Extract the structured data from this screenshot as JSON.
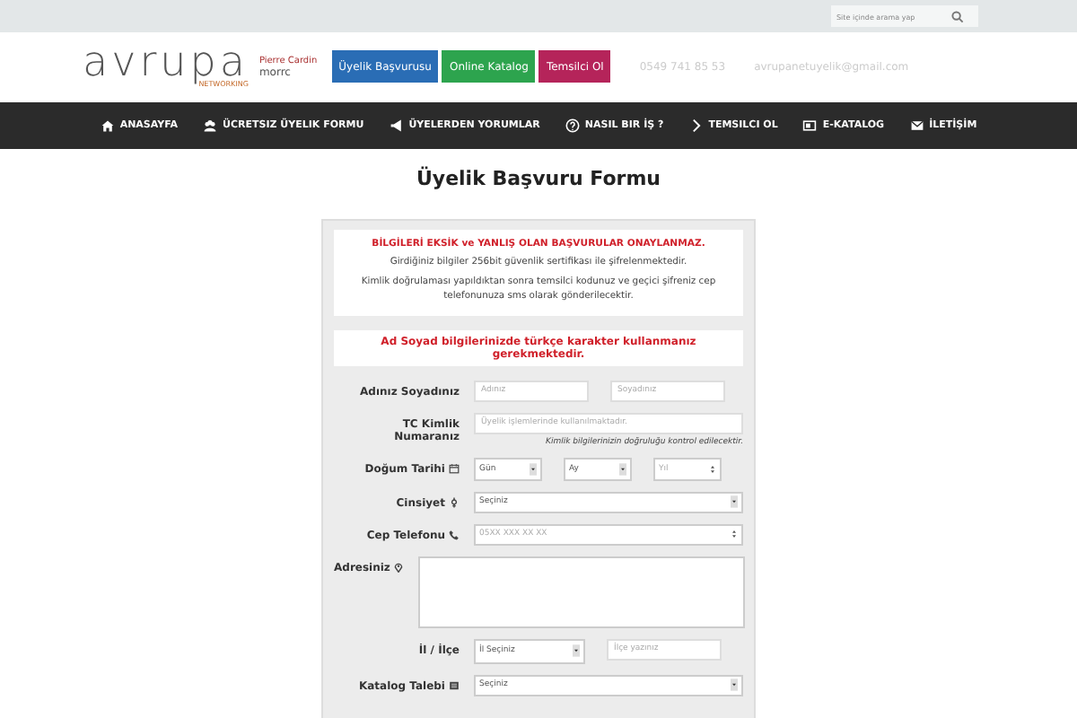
{
  "top_bar": {
    "search": {
      "placeholder": "Site içinde arama yap"
    }
  },
  "header": {
    "logo": {
      "name": "avrupa",
      "sub": "NETWORKING"
    },
    "partner_logos": [
      "Pierre Cardin",
      "morrc"
    ],
    "buttons": [
      {
        "label": "Üyelik Başvurusu",
        "color": "#2a6db5"
      },
      {
        "label": "Online Katalog",
        "color": "#2da44e"
      },
      {
        "label": "Temsilci Ol",
        "color": "#b5245a"
      }
    ],
    "phone": "0549 741 85 53",
    "email": "avrupanetuyelik@gmail.com"
  },
  "nav": [
    {
      "label": "ANASAYFA"
    },
    {
      "label": "ÜCRETSIZ ÜYELIK FORMU"
    },
    {
      "label": "ÜYELERDEN YORUMLAR"
    },
    {
      "label": "NASIL BIR İŞ ?"
    },
    {
      "label": "TEMSILCI OL"
    },
    {
      "label": "E-KATALOG"
    },
    {
      "label": "İLETİŞİM"
    }
  ],
  "page_title": "Üyelik Başvuru Formu",
  "notice": {
    "warning": "BİLGİLERİ EKSİK ve YANLIŞ OLAN BAŞVURULAR ONAYLANMAZ.",
    "lines": [
      "Girdiğiniz bilgiler 256bit güvenlik sertifikası ile şifrelenmektedir.",
      "Kimlik doğrulaması yapıldıktan sonra temsilci kodunuz ve geçici şifreniz cep telefonunuza sms olarak gönderilecektir."
    ]
  },
  "name_notice": "Ad Soyad bilgilerinizde türkçe karakter kullanmanız gerekmektedir.",
  "rows": [
    {
      "kind": "pair",
      "label": "Adınız Soyadınız",
      "fields": [
        {
          "placeholder": "Adınız"
        },
        {
          "placeholder": "Soyadınız"
        }
      ]
    },
    {
      "kind": "single",
      "label": "TC Kimlik Numaranız",
      "fields": [
        {
          "placeholder": "Üyelik işlemlerinde kullanılmaktadır."
        }
      ],
      "hint": "Kimlik bilgilerinizin doğruluğu kontrol edilecektir."
    },
    {
      "kind": "date",
      "label": "Doğum Tarihi",
      "fields": [
        {
          "value": "Gün"
        },
        {
          "value": "Ay"
        },
        {
          "placeholder": "Yıl"
        }
      ]
    },
    {
      "kind": "select",
      "label": "Cinsiyet",
      "fields": [
        {
          "value": "Seçiniz"
        }
      ]
    },
    {
      "kind": "number",
      "label": "Cep Telefonu",
      "fields": [
        {
          "placeholder": "05XX XXX XX XX"
        }
      ]
    },
    {
      "kind": "textarea",
      "label": "Adresiniz",
      "fields": []
    },
    {
      "kind": "city",
      "label": "İl / İlçe",
      "fields": [
        {
          "value": "İl Seçiniz"
        },
        {
          "placeholder": "İlçe yazınız"
        }
      ]
    },
    {
      "kind": "select",
      "label": "Katalog Talebi",
      "fields": [
        {
          "value": "Seçiniz"
        }
      ]
    }
  ]
}
